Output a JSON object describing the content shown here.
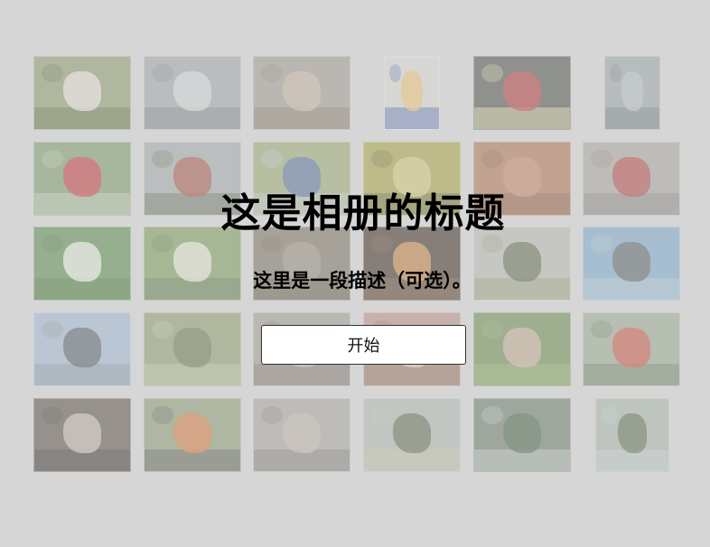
{
  "album": {
    "title": "这是相册的标题",
    "description": "这里是一段描述（可选）。",
    "start_label": "开始"
  },
  "photos": [
    {
      "name": "photo-girl-smiling",
      "bg": "#8a9a6a",
      "fg": "#f0e8e0",
      "fg2": "#4a5a2a"
    },
    {
      "name": "photo-walkway-railing",
      "bg": "#9ea6a8",
      "fg": "#d8dcdc",
      "fg2": "#6a7070"
    },
    {
      "name": "photo-cat-lying",
      "bg": "#a09a90",
      "fg": "#c8b8a0",
      "fg2": "#7a6a5a"
    },
    {
      "name": "photo-child-costume",
      "bg": "#d8d8d0",
      "fg": "#f0c060",
      "fg2": "#3050a0"
    },
    {
      "name": "photo-market-price-sign",
      "bg": "#4a5048",
      "fg": "#c03030",
      "fg2": "#e8e0a0"
    },
    {
      "name": "photo-water-surface",
      "bg": "#9aa4a4",
      "fg": "#b8c0c0",
      "fg2": "#606868"
    },
    {
      "name": "photo-red-flowers-lens",
      "bg": "#7a9a6a",
      "fg": "#d02030",
      "fg2": "#c0d0b0"
    },
    {
      "name": "photo-temple-building",
      "bg": "#a0a8a8",
      "fg": "#a04030",
      "fg2": "#4a5a3a"
    },
    {
      "name": "photo-man-in-field",
      "bg": "#9aa870",
      "fg": "#4060a0",
      "fg2": "#c0c8d0"
    },
    {
      "name": "photo-food-tray",
      "bg": "#a8a040",
      "fg": "#d8d080",
      "fg2": "#4a5a20"
    },
    {
      "name": "photo-brick-wall",
      "bg": "#b07050",
      "fg": "#c88868",
      "fg2": "#7a4a30"
    },
    {
      "name": "photo-red-boot-stones",
      "bg": "#a8a49c",
      "fg": "#b03030",
      "fg2": "#7a7470"
    },
    {
      "name": "photo-white-lilies",
      "bg": "#5a8a4a",
      "fg": "#f8f8f0",
      "fg2": "#3a6a2a"
    },
    {
      "name": "photo-daisies",
      "bg": "#7a9a5a",
      "fg": "#f0f0e0",
      "fg2": "#4a6a3a"
    },
    {
      "name": "photo-ground-soil",
      "bg": "#7a7060",
      "fg": "#9a9080",
      "fg2": "#5a5040"
    },
    {
      "name": "photo-sparkler-light",
      "bg": "#3a2a20",
      "fg": "#e09040",
      "fg2": "#6a4a30"
    },
    {
      "name": "photo-trees-skyline",
      "bg": "#b8b8b0",
      "fg": "#4a5a3a",
      "fg2": "#8a9060"
    },
    {
      "name": "photo-hand-against-sky",
      "bg": "#7aa8c8",
      "fg": "#505050",
      "fg2": "#a8c8d8"
    },
    {
      "name": "photo-people-by-river",
      "bg": "#a0b8d0",
      "fg": "#404850",
      "fg2": "#7a8890"
    },
    {
      "name": "photo-boy-on-bicycle",
      "bg": "#8a9a6a",
      "fg": "#5a6a40",
      "fg2": "#c0c8a0"
    },
    {
      "name": "photo-pavement",
      "bg": "#a09890",
      "fg": "#b8b0a8",
      "fg2": "#6a6058"
    },
    {
      "name": "photo-hands-holding",
      "bg": "#b89080",
      "fg": "#e8d0c0",
      "fg2": "#7a5a4a"
    },
    {
      "name": "photo-grasshopper-in-hand",
      "bg": "#6a8a4a",
      "fg": "#d0b0a0",
      "fg2": "#8ab060"
    },
    {
      "name": "photo-road-with-trees",
      "bg": "#9aa890",
      "fg": "#d04030",
      "fg2": "#5a6a4a"
    },
    {
      "name": "photo-silhouette-pavilion",
      "bg": "#5a5048",
      "fg": "#c8c0b0",
      "fg2": "#2a2420"
    },
    {
      "name": "photo-girl-orange-shirt",
      "bg": "#8a9870",
      "fg": "#e07030",
      "fg2": "#404040"
    },
    {
      "name": "photo-cat-street",
      "bg": "#a8a49c",
      "fg": "#c0b8a8",
      "fg2": "#6a6460"
    },
    {
      "name": "photo-two-trees-field",
      "bg": "#b0b8b0",
      "fg": "#4a5a3a",
      "fg2": "#c8c0a0"
    },
    {
      "name": "photo-tree-water",
      "bg": "#6a7a6a",
      "fg": "#3a5a3a",
      "fg2": "#c0c8c0"
    },
    {
      "name": "photo-lakeside-tree",
      "bg": "#a8b4a8",
      "fg": "#4a5a3a",
      "fg2": "#c0d0d0"
    }
  ]
}
